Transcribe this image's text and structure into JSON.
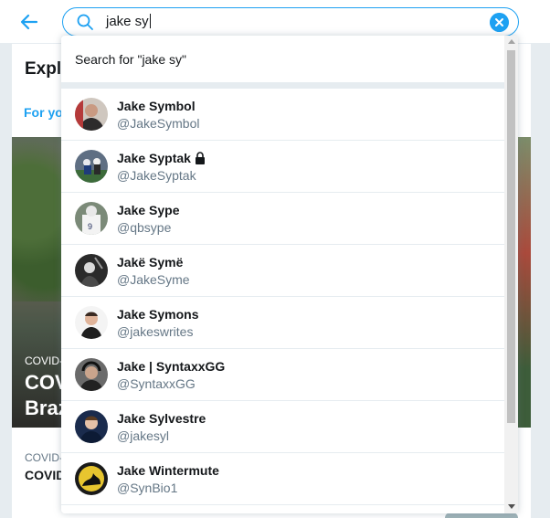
{
  "search": {
    "query": "jake sy"
  },
  "explore": {
    "title": "Explo",
    "tab": "For yo",
    "hero": {
      "category": "COVID-",
      "headline_1": "COV",
      "headline_2": "Braz"
    },
    "story": {
      "category": "COVID-",
      "title": "COVID"
    }
  },
  "dropdown": {
    "search_for": "Search for \"jake sy\"",
    "results": [
      {
        "name": "Jake Symbol",
        "handle": "@JakeSymbol",
        "locked": false
      },
      {
        "name": "Jake Syptak",
        "handle": "@JakeSyptak",
        "locked": true
      },
      {
        "name": "Jake Sype",
        "handle": "@qbsype",
        "locked": false
      },
      {
        "name": "Jakë Symë",
        "handle": "@JakeSyme",
        "locked": false
      },
      {
        "name": "Jake Symons",
        "handle": "@jakeswrites",
        "locked": false
      },
      {
        "name": "Jake | SyntaxxGG",
        "handle": "@SyntaxxGG",
        "locked": false
      },
      {
        "name": "Jake Sylvestre",
        "handle": "@jakesyl",
        "locked": false
      },
      {
        "name": "Jake Wintermute",
        "handle": "@SynBio1",
        "locked": false
      }
    ]
  },
  "colors": {
    "accent": "#1da1f2",
    "text": "#14171a",
    "secondary": "#657786",
    "divider": "#e6ecf0"
  },
  "icons": {
    "back": "arrow-left-icon",
    "search": "search-icon",
    "clear": "close-icon",
    "lock": "lock-icon"
  }
}
